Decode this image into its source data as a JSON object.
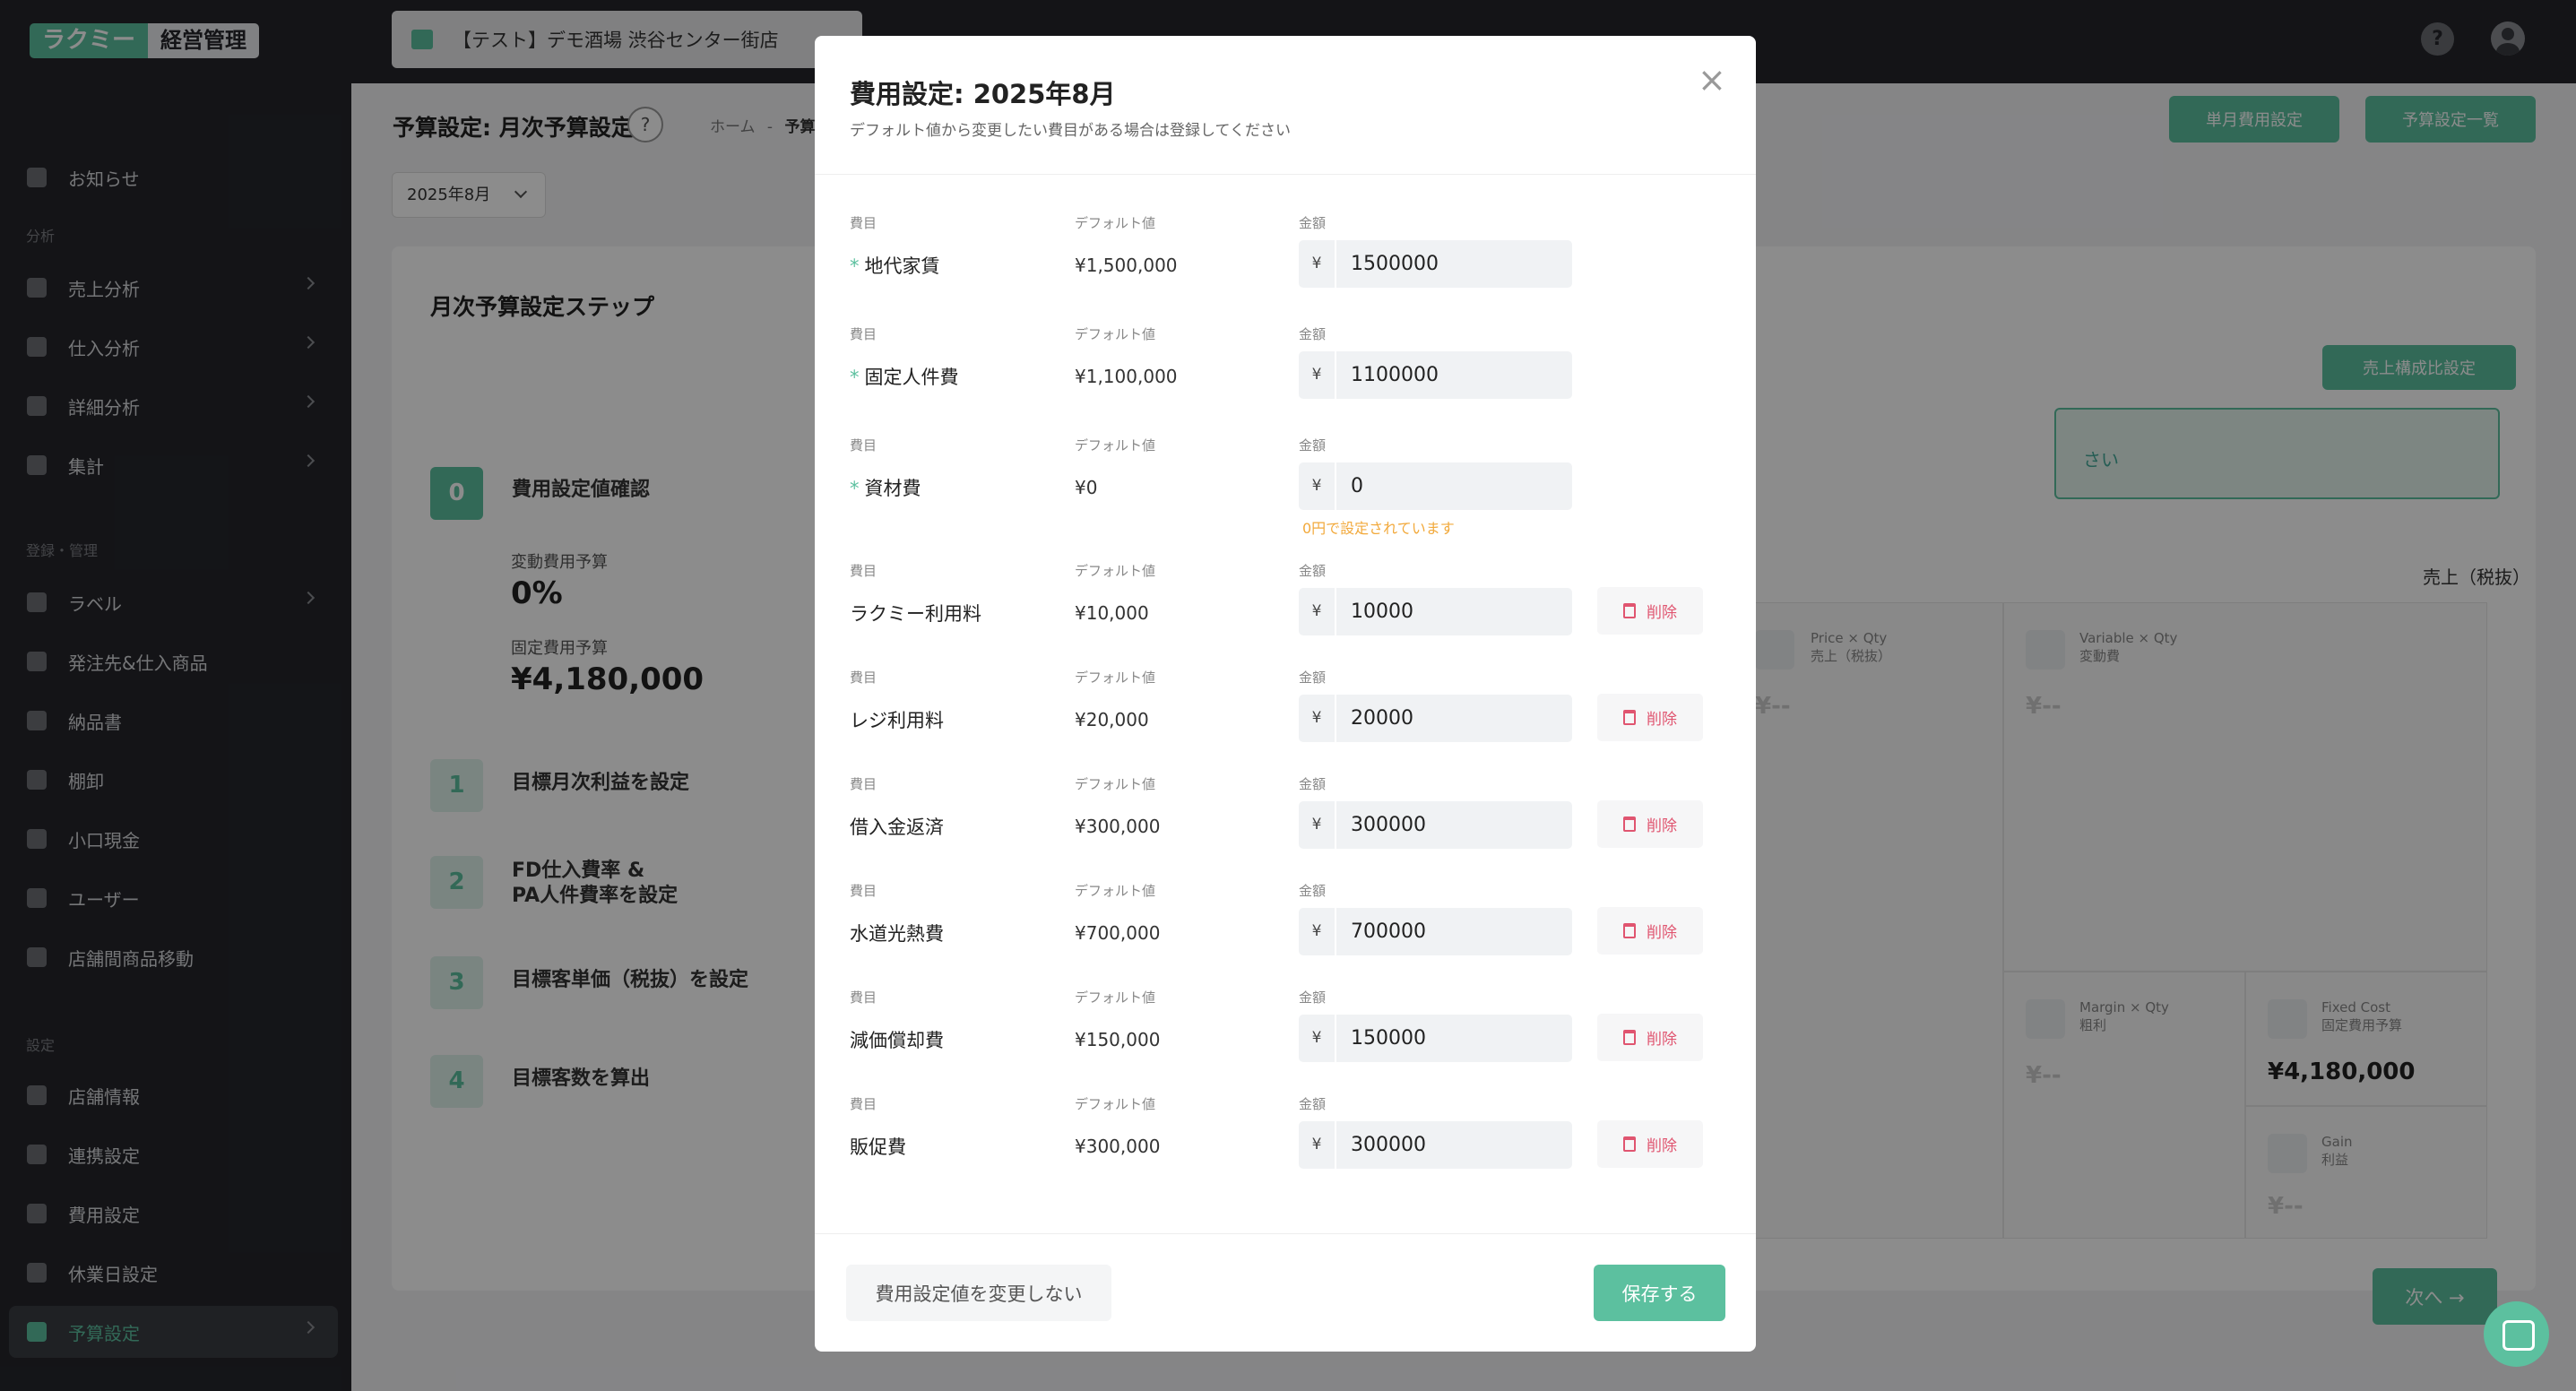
{
  "topbar": {
    "logo_part1": "ラクミー",
    "logo_part2": "経営管理",
    "store_name": "【テスト】デモ酒場 渋谷センター街店",
    "help": "?"
  },
  "sidebar": {
    "sections": {
      "analysis": "分析",
      "registration": "登録・管理",
      "settings": "設定"
    },
    "items": [
      {
        "label": "お知らせ"
      },
      {
        "label": "売上分析"
      },
      {
        "label": "仕入分析"
      },
      {
        "label": "詳細分析"
      },
      {
        "label": "集計"
      },
      {
        "label": "ラベル"
      },
      {
        "label": "発注先&仕入商品"
      },
      {
        "label": "納品書"
      },
      {
        "label": "棚卸"
      },
      {
        "label": "小口現金"
      },
      {
        "label": "ユーザー"
      },
      {
        "label": "店舗間商品移動"
      },
      {
        "label": "店舗情報"
      },
      {
        "label": "連携設定"
      },
      {
        "label": "費用設定"
      },
      {
        "label": "休業日設定"
      },
      {
        "label": "予算設定"
      }
    ]
  },
  "main": {
    "title": "予算設定: 月次予算設定",
    "help": "?",
    "breadcrumb_home": "ホーム",
    "breadcrumb_sep": "-",
    "breadcrumb_current": "予算設",
    "btn_single_cost": "単月費用設定",
    "btn_budget_list": "予算設定一覧",
    "month": "2025年8月",
    "steps_title": "月次予算設定ステップ",
    "steps": [
      {
        "num": "0",
        "label": "費用設定値確認"
      },
      {
        "num": "1",
        "label": "目標月次利益を設定"
      },
      {
        "num": "2",
        "label": "FD仕入費率 &\nPA人件費率を設定"
      },
      {
        "num": "3",
        "label": "目標客単価（税抜）を設定"
      },
      {
        "num": "4",
        "label": "目標客数を算出"
      }
    ],
    "variable_cost_label": "変動費用予算",
    "variable_cost_value": "0%",
    "fixed_cost_label": "固定費用予算",
    "fixed_cost_value": "¥4,180,000",
    "sales_ratio_btn": "売上構成比設定",
    "info_text": "さい",
    "sales_header": "売上（税抜）",
    "boxes": {
      "pq_en": "Price × Qty",
      "pq_jp": "売上（税抜）",
      "pq_val": "¥--",
      "vq_en": "Variable × Qty",
      "vq_jp": "変動費",
      "vq_val": "¥--",
      "mq_en": "Margin × Qty",
      "mq_jp": "粗利",
      "mq_val": "¥--",
      "fc_en": "Fixed Cost",
      "fc_jp": "固定費用予算",
      "fc_val": "¥4,180,000",
      "g_en": "Gain",
      "g_jp": "利益",
      "g_val": "¥--"
    },
    "next": "次へ →"
  },
  "modal": {
    "title": "費用設定: 2025年8月",
    "subtitle": "デフォルト値から変更したい費目がある場合は登録してください",
    "close": "×",
    "col_item": "費目",
    "col_default": "デフォルト値",
    "col_amount": "金額",
    "yen": "¥",
    "delete": "削除",
    "required_mark": "*",
    "rows": [
      {
        "name": "地代家賃",
        "default": "¥1,500,000",
        "amount": "1500000"
      },
      {
        "name": "固定人件費",
        "default": "¥1,100,000",
        "amount": "1100000"
      },
      {
        "name": "資材費",
        "default": "¥0",
        "amount": "0",
        "warning": "0円で設定されています"
      },
      {
        "name": "ラクミー利用料",
        "default": "¥10,000",
        "amount": "10000"
      },
      {
        "name": "レジ利用料",
        "default": "¥20,000",
        "amount": "20000"
      },
      {
        "name": "借入金返済",
        "default": "¥300,000",
        "amount": "300000"
      },
      {
        "name": "水道光熱費",
        "default": "¥700,000",
        "amount": "700000"
      },
      {
        "name": "減価償却費",
        "default": "¥150,000",
        "amount": "150000"
      },
      {
        "name": "販促費",
        "default": "¥300,000",
        "amount": "300000"
      }
    ],
    "cancel": "費用設定値を変更しない",
    "save": "保存する"
  },
  "colors": {
    "accent": "#5cc09f",
    "danger": "#e05570",
    "warning": "#f2a93b",
    "sidebar": "#25262b"
  }
}
